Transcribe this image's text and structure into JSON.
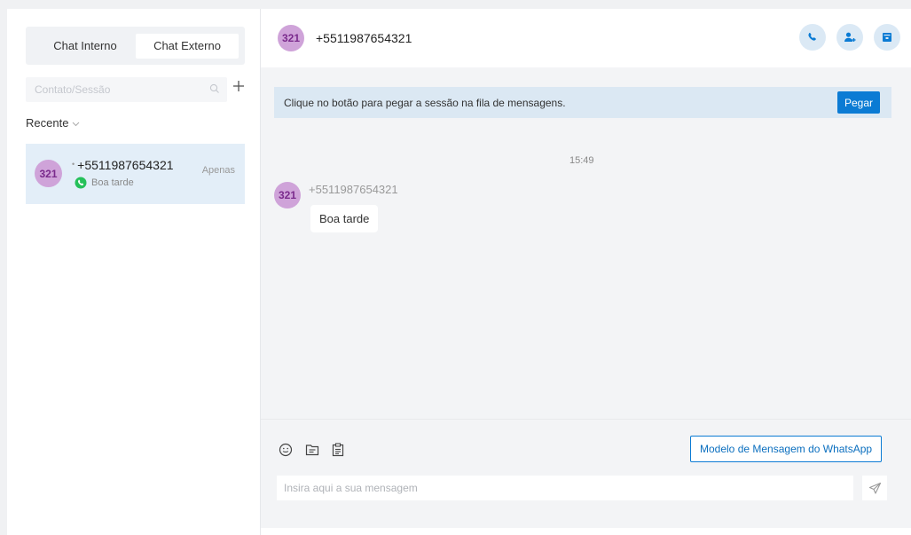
{
  "sidebar": {
    "tabs": [
      {
        "label": "Chat Interno"
      },
      {
        "label": "Chat Externo"
      }
    ],
    "search_placeholder": "Contato/Sessão",
    "recent_label": "Recente",
    "session": {
      "avatar": "321",
      "name": "+5511987654321",
      "tag": "Apenas",
      "preview": "Boa tarde",
      "channel_icon": "whatsapp-icon"
    }
  },
  "header": {
    "avatar": "321",
    "title": "+5511987654321",
    "actions": [
      "phone-icon",
      "add-user-icon",
      "archive-icon"
    ]
  },
  "notice": {
    "text": "Clique no botão para pegar a sessão na fila de mensagens.",
    "button": "Pegar"
  },
  "messages": [
    {
      "time": "15:49",
      "avatar": "321",
      "sender": "+5511987654321",
      "text": "Boa tarde"
    }
  ],
  "composer": {
    "tools": [
      "emoji-icon",
      "file-icon",
      "clipboard-icon"
    ],
    "template_button": "Modelo de Mensagem do WhatsApp",
    "input_placeholder": "Insira aqui a sua mensagem",
    "send_icon": "send-icon"
  },
  "colors": {
    "accent": "#0b7bd4",
    "avatar_bg": "#cfa3d9",
    "avatar_text": "#7a2a8c",
    "selected_session": "#e3eef8",
    "notice_bg": "#dbe8f3",
    "whatsapp": "#25c05a"
  }
}
